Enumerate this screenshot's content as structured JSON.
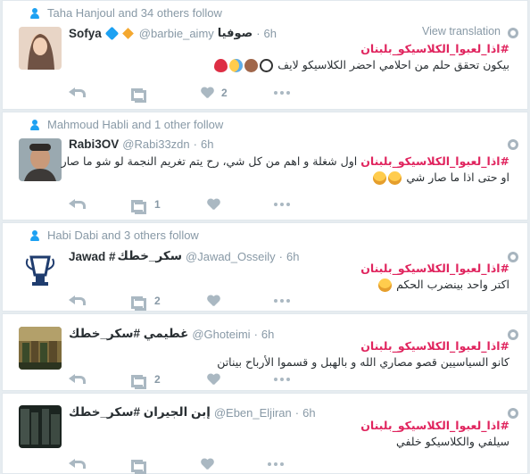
{
  "tweets": [
    {
      "context": "Taha Hanjoul and 34 others follow",
      "name": "Sofya",
      "handle": "@barbie_aimy",
      "handle_suffix": "صوفيا",
      "time": "6h",
      "view_translation": "View translation",
      "hashtag": "#اذا_لعبوا_الكلاسيكو_بلبنان",
      "text": "بيكون تحقق حلم من احلامي احضر الكلاسيكو لايف",
      "emojis": [
        "ball-icon",
        "monkey-icon",
        "cry-icon",
        "heart-icon"
      ],
      "likes": "2",
      "retweets": "",
      "avatar_colors": [
        "#e8d5c6",
        "#5a3c2e"
      ]
    },
    {
      "context": "Mahmoud Habli and 1 other follow",
      "name": "Rabi3OV",
      "handle": "@Rabi33zdn",
      "time": "6h",
      "hashtag": "#اذا_لعبوا_الكلاسيكو_بلبنان",
      "text": "اول شغلة و اهم من كل شي، رح يتم تغريم النجمة لو شو ما صار او حتى اذا ما صار شي",
      "emojis": [
        "laugh-icon",
        "laugh-icon"
      ],
      "retweets": "1",
      "likes": "",
      "avatar_colors": [
        "#9aa9b0",
        "#3d3a38"
      ]
    },
    {
      "context": "Habi Dabi and 3 others follow",
      "name": "Jawad #",
      "name_suffix": "سكر_خطك",
      "handle": "@Jawad_Osseily",
      "time": "6h",
      "hashtag": "#اذا_لعبوا_الكلاسيكو_بلبنان",
      "text": "اكتر واحد بينضرب الحكم",
      "emojis": [
        "laugh-icon"
      ],
      "retweets": "2",
      "likes": "",
      "avatar_colors": [
        "#ffffff",
        "#1f3c6e"
      ]
    },
    {
      "name": "غطيمي #سكر_خطك",
      "handle": "@Ghoteimi",
      "time": "6h",
      "hashtag": "#اذا_لعبوا_الكلاسيكو_بلبنان",
      "text": "كانو السياسيين قصو مصاري الله و بالهبل و قسموا الأرباح بيناتن",
      "emojis": [],
      "retweets": "2",
      "likes": "",
      "avatar_colors": [
        "#7d6b3c",
        "#3a4a2a"
      ]
    },
    {
      "name": "إبن الجيران #سكر_خطك",
      "handle": "@Eben_Eljiran",
      "time": "6h",
      "hashtag": "#اذا_لعبوا_الكلاسيكو_بلبنان",
      "text": "سيلفي والكلاسيكو خلفي",
      "emojis": [],
      "retweets": "",
      "likes": "",
      "avatar_colors": [
        "#4f5d55",
        "#1b2420"
      ]
    }
  ]
}
